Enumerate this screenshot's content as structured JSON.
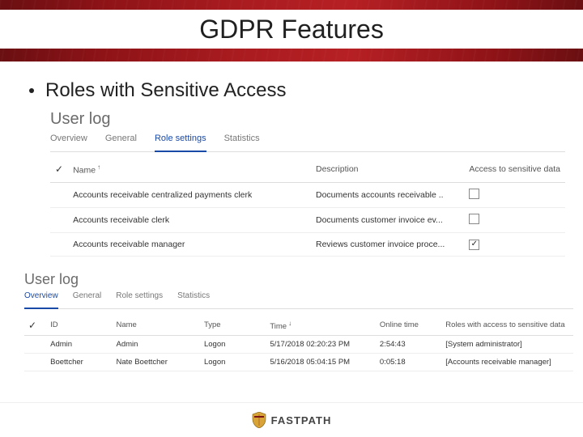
{
  "slide": {
    "title": "GDPR Features",
    "bullet": "Roles with Sensitive Access"
  },
  "panel1": {
    "heading": "User log",
    "tabs": [
      "Overview",
      "General",
      "Role settings",
      "Statistics"
    ],
    "active_tab_index": 2,
    "columns": {
      "name": "Name",
      "description": "Description",
      "access": "Access to sensitive data"
    },
    "rows": [
      {
        "name": "Accounts receivable centralized payments clerk",
        "description": "Documents accounts receivable ..",
        "access": false
      },
      {
        "name": "Accounts receivable clerk",
        "description": "Documents customer invoice ev...",
        "access": false
      },
      {
        "name": "Accounts receivable manager",
        "description": "Reviews customer invoice proce...",
        "access": true
      }
    ]
  },
  "panel2": {
    "heading": "User log",
    "tabs": [
      "Overview",
      "General",
      "Role settings",
      "Statistics"
    ],
    "active_tab_index": 0,
    "columns": {
      "id": "ID",
      "name": "Name",
      "type": "Type",
      "time": "Time",
      "online": "Online time",
      "roles": "Roles with access to sensitive data"
    },
    "rows": [
      {
        "id": "Admin",
        "name": "Admin",
        "type": "Logon",
        "time": "5/17/2018 02:20:23 PM",
        "online": "2:54:43",
        "roles": "[System administrator]"
      },
      {
        "id": "Boettcher",
        "name": "Nate Boettcher",
        "type": "Logon",
        "time": "5/16/2018 05:04:15 PM",
        "online": "0:05:18",
        "roles": "[Accounts receivable manager]"
      }
    ]
  },
  "footer": {
    "brand": "FASTPATH"
  }
}
